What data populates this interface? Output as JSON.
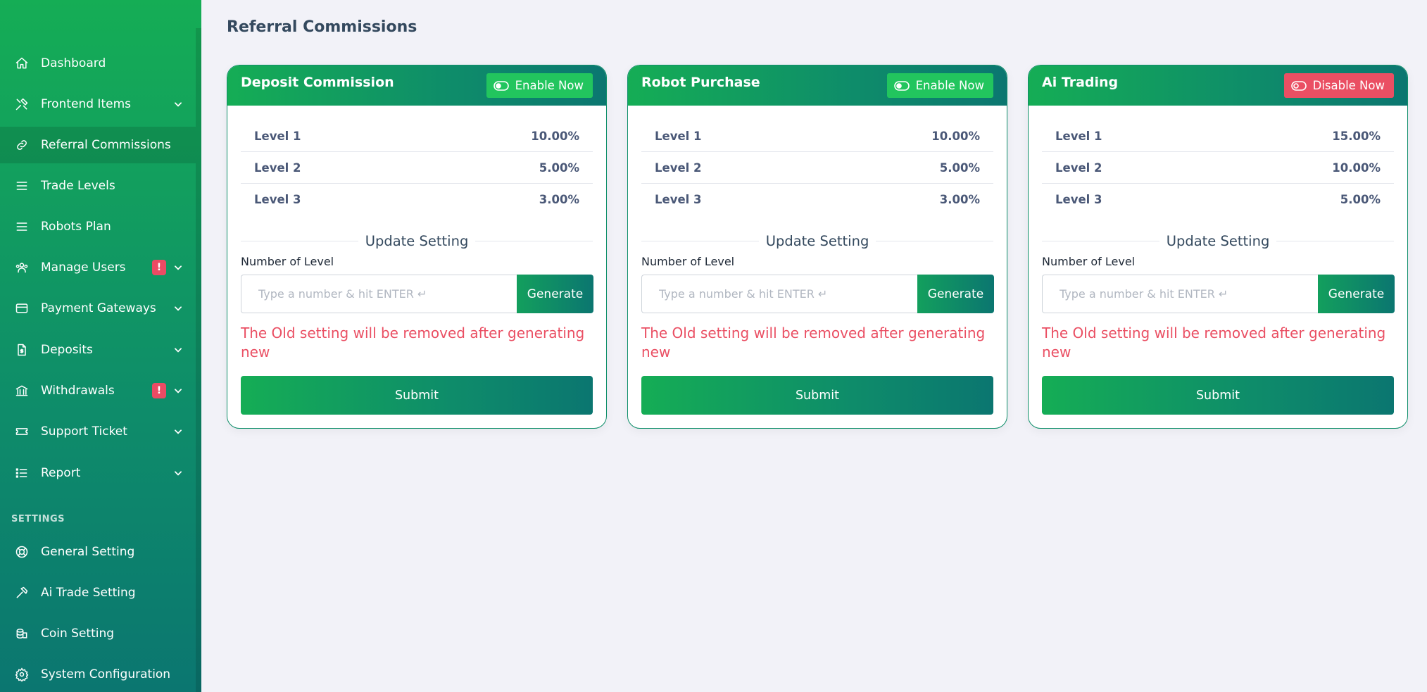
{
  "sidebar": {
    "items": [
      {
        "label": "Dashboard",
        "icon": "home-icon",
        "badge": "",
        "chevron": false,
        "active": false
      },
      {
        "label": "Frontend Items",
        "icon": "tools-icon",
        "badge": "",
        "chevron": true,
        "active": false
      },
      {
        "label": "Referral Commissions",
        "icon": "link-icon",
        "badge": "",
        "chevron": false,
        "active": true
      },
      {
        "label": "Trade Levels",
        "icon": "list-icon",
        "badge": "",
        "chevron": false,
        "active": false
      },
      {
        "label": "Robots Plan",
        "icon": "list-icon",
        "badge": "",
        "chevron": false,
        "active": false
      },
      {
        "label": "Manage Users",
        "icon": "users-icon",
        "badge": "!",
        "chevron": true,
        "active": false
      },
      {
        "label": "Payment Gateways",
        "icon": "credit-card-icon",
        "badge": "",
        "chevron": true,
        "active": false
      },
      {
        "label": "Deposits",
        "icon": "file-dollar-icon",
        "badge": "",
        "chevron": true,
        "active": false
      },
      {
        "label": "Withdrawals",
        "icon": "bank-icon",
        "badge": "!",
        "chevron": true,
        "active": false
      },
      {
        "label": "Support Ticket",
        "icon": "ticket-icon",
        "badge": "",
        "chevron": true,
        "active": false
      },
      {
        "label": "Report",
        "icon": "list-details-icon",
        "badge": "",
        "chevron": true,
        "active": false
      }
    ],
    "section_label": "SETTINGS",
    "settings_items": [
      {
        "label": "General Setting",
        "icon": "lifebuoy-icon"
      },
      {
        "label": "Ai Trade Setting",
        "icon": "hammer-icon"
      },
      {
        "label": "Coin Setting",
        "icon": "coins-icon"
      },
      {
        "label": "System Configuration",
        "icon": "gear-icon"
      }
    ]
  },
  "page": {
    "title": "Referral Commissions"
  },
  "cards": [
    {
      "title": "Deposit Commission",
      "toggle_label": "Enable Now",
      "toggle_state": "enable",
      "levels": [
        {
          "label": "Level 1",
          "value": "10.00%"
        },
        {
          "label": "Level 2",
          "value": "5.00%"
        },
        {
          "label": "Level 3",
          "value": "3.00%"
        }
      ],
      "update_title": "Update Setting",
      "field_label": "Number of Level",
      "placeholder": "Type a number & hit ENTER ↵",
      "generate_label": "Generate",
      "warning": "The Old setting will be removed after generating new",
      "submit_label": "Submit"
    },
    {
      "title": "Robot Purchase",
      "toggle_label": "Enable Now",
      "toggle_state": "enable",
      "levels": [
        {
          "label": "Level 1",
          "value": "10.00%"
        },
        {
          "label": "Level 2",
          "value": "5.00%"
        },
        {
          "label": "Level 3",
          "value": "3.00%"
        }
      ],
      "update_title": "Update Setting",
      "field_label": "Number of Level",
      "placeholder": "Type a number & hit ENTER ↵",
      "generate_label": "Generate",
      "warning": "The Old setting will be removed after generating new",
      "submit_label": "Submit"
    },
    {
      "title": "Ai Trading",
      "toggle_label": "Disable Now",
      "toggle_state": "disable",
      "levels": [
        {
          "label": "Level 1",
          "value": "15.00%"
        },
        {
          "label": "Level 2",
          "value": "10.00%"
        },
        {
          "label": "Level 3",
          "value": "5.00%"
        }
      ],
      "update_title": "Update Setting",
      "field_label": "Number of Level",
      "placeholder": "Type a number & hit ENTER ↵",
      "generate_label": "Generate",
      "warning": "The Old setting will be removed after generating new",
      "submit_label": "Submit"
    }
  ],
  "colors": {
    "brand_green": "#15ad55",
    "brand_teal": "#0b7670",
    "enable_green": "#22c55e",
    "danger_red": "#ea4f63",
    "page_bg": "#f2f2f8"
  }
}
